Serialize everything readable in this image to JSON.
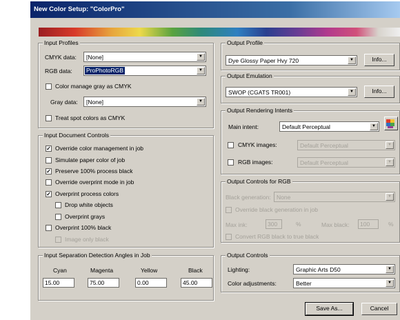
{
  "window": {
    "title": "New Color Setup: \"ColorPro\""
  },
  "input_profiles": {
    "label": "Input Profiles",
    "cmyk_label": "CMYK data:",
    "cmyk_value": "[None]",
    "rgb_label": "RGB data:",
    "rgb_value": "ProPhotoRGB",
    "manage_gray_label": "Color manage gray as CMYK",
    "manage_gray_checked": false,
    "gray_label": "Gray data:",
    "gray_value": "[None]",
    "spot_label": "Treat spot colors as CMYK",
    "spot_checked": false
  },
  "input_doc_controls": {
    "label": "Input Document Controls",
    "items": [
      {
        "label": "Override color management in job",
        "checked": true,
        "disabled": false
      },
      {
        "label": "Simulate paper color of job",
        "checked": false,
        "disabled": false
      },
      {
        "label": "Preserve 100% process black",
        "checked": true,
        "disabled": false
      },
      {
        "label": "Override overprint mode in job",
        "checked": false,
        "disabled": false
      },
      {
        "label": "Overprint process colors",
        "checked": true,
        "disabled": false
      },
      {
        "label": "Drop white objects",
        "checked": false,
        "disabled": false
      },
      {
        "label": "Overprint grays",
        "checked": false,
        "disabled": false
      },
      {
        "label": "Overprint 100% black",
        "checked": false,
        "disabled": false
      },
      {
        "label": "Image only black",
        "checked": false,
        "disabled": true
      }
    ]
  },
  "separation_angles": {
    "label": "Input Separation Detection Angles in Job",
    "columns": [
      "Cyan",
      "Magenta",
      "Yellow",
      "Black"
    ],
    "values": [
      "15.00",
      "75.00",
      "0.00",
      "45.00"
    ]
  },
  "output_profile": {
    "label": "Output Profile",
    "value": "Dye Glossy Paper Hvy 720",
    "info_label": "Info..."
  },
  "output_emulation": {
    "label": "Output Emulation",
    "value": "SWOP (CGATS TR001)",
    "info_label": "Info..."
  },
  "rendering_intents": {
    "label": "Output Rendering Intents",
    "main_label": "Main intent:",
    "main_value": "Default Perceptual",
    "cmyk_label": "CMYK images:",
    "cmyk_value": "Default Perceptual",
    "cmyk_checked": false,
    "rgb_label": "RGB images:",
    "rgb_value": "Default Perceptual",
    "rgb_checked": false
  },
  "output_rgb": {
    "label": "Output Controls for RGB",
    "black_gen_label": "Black generation:",
    "black_gen_value": "None",
    "override_label": "Override black generation in job",
    "max_ink_label": "Max ink:",
    "max_ink_value": "300",
    "max_ink_unit": "%",
    "max_black_label": "Max black:",
    "max_black_value": "100",
    "max_black_unit": "%",
    "convert_label": "Convert RGB black to true black"
  },
  "output_controls": {
    "label": "Output Controls",
    "lighting_label": "Lighting:",
    "lighting_value": "Graphic Arts D50",
    "color_adj_label": "Color adjustments:",
    "color_adj_value": "Better"
  },
  "buttons": {
    "save_as": "Save As...",
    "cancel": "Cancel"
  }
}
